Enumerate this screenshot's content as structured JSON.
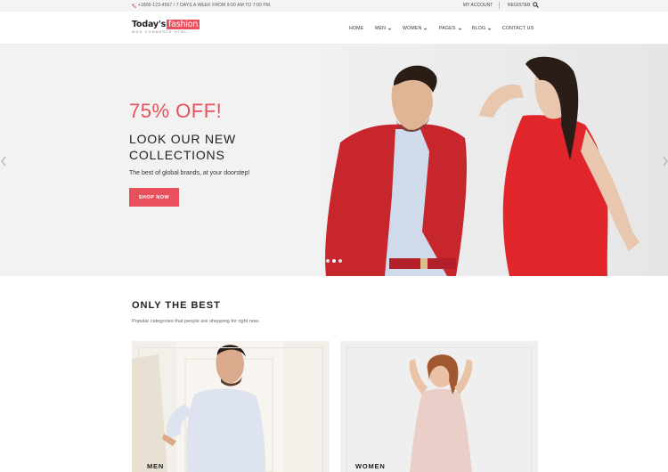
{
  "topbar": {
    "phone": "+1800-123-4567 / 7 DAYS A WEEK FROM 9:00 AM TO 7:00 PM.",
    "my_account": "MY ACCOUNT",
    "register": "REGISTER"
  },
  "logo": {
    "main": "Today's",
    "highlight": "fashion",
    "tagline": "WOO COMMERCE HTML"
  },
  "nav": {
    "items": [
      {
        "label": "HOME"
      },
      {
        "label": "MEN"
      },
      {
        "label": "WOMEN"
      },
      {
        "label": "PAGES"
      },
      {
        "label": "BLOG"
      },
      {
        "label": "CONTACT US"
      }
    ]
  },
  "hero": {
    "offer": "75% OFF!",
    "headline": "LOOK OUR NEW COLLECTIONS",
    "subtext": "The best of global brands, at your doorstep!",
    "cta": "SHOP NOW",
    "slide_count": 3,
    "active_slide": 2
  },
  "section": {
    "title": "ONLY THE BEST",
    "subtitle": "Popular categories that people are shopping for right now."
  },
  "categories": [
    {
      "label": "MEN"
    },
    {
      "label": "WOMEN"
    }
  ],
  "colors": {
    "accent": "#e8505b",
    "jacket": "#c8262d",
    "dress": "#e0262a"
  }
}
